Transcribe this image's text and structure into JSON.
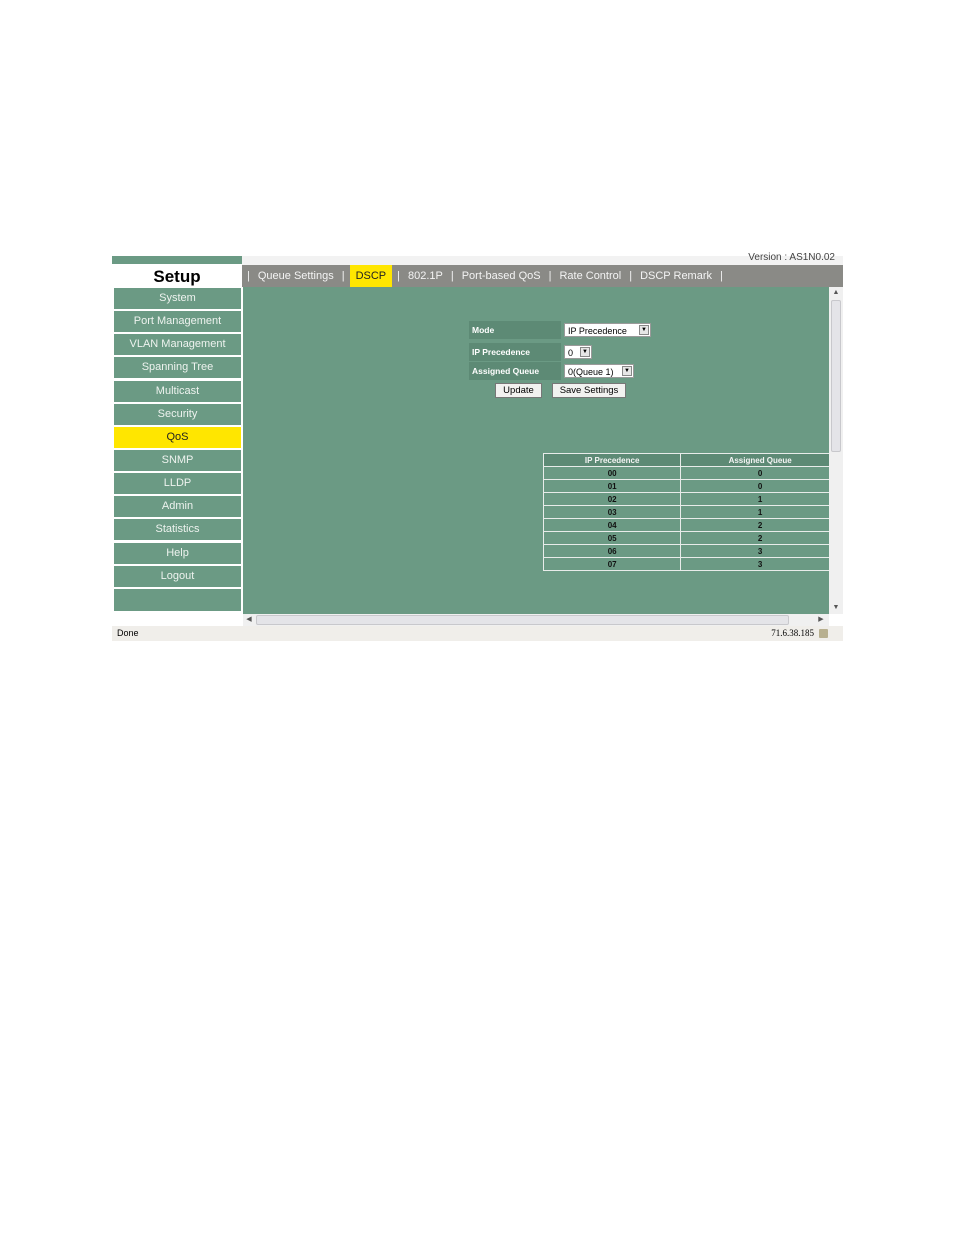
{
  "sidebar": {
    "title": "Setup",
    "items": [
      {
        "label": "System"
      },
      {
        "label": "Port Management"
      },
      {
        "label": "VLAN Management"
      },
      {
        "label": "Spanning Tree"
      },
      {
        "label": "Multicast"
      },
      {
        "label": "Security"
      },
      {
        "label": "QoS",
        "active": true
      },
      {
        "label": "SNMP"
      },
      {
        "label": "LLDP"
      },
      {
        "label": "Admin"
      },
      {
        "label": "Statistics"
      },
      {
        "label": "Help"
      },
      {
        "label": "Logout"
      }
    ]
  },
  "header": {
    "version": "Version : AS1N0.02",
    "tabs": [
      {
        "label": "Queue Settings"
      },
      {
        "label": "DSCP",
        "active": true
      },
      {
        "label": "802.1P"
      },
      {
        "label": "Port-based QoS"
      },
      {
        "label": "Rate Control"
      },
      {
        "label": "DSCP Remark"
      }
    ],
    "separator": "|"
  },
  "form": {
    "mode_label": "Mode",
    "mode_value": "IP Precedence",
    "ip_precedence_label": "IP Precedence",
    "ip_precedence_value": "0",
    "assigned_queue_label": "Assigned Queue",
    "assigned_queue_value": "0(Queue 1)",
    "update_label": "Update",
    "save_label": "Save Settings"
  },
  "table": {
    "headers": [
      "IP Precedence",
      "Assigned Queue"
    ],
    "rows": [
      [
        "00",
        "0"
      ],
      [
        "01",
        "0"
      ],
      [
        "02",
        "1"
      ],
      [
        "03",
        "1"
      ],
      [
        "04",
        "2"
      ],
      [
        "05",
        "2"
      ],
      [
        "06",
        "3"
      ],
      [
        "07",
        "3"
      ]
    ]
  },
  "statusbar": {
    "status": "Done",
    "address": "71.6.38.185"
  },
  "colors": {
    "panel_green": "#6b9a84",
    "label_green": "#5d8a75",
    "active_yellow": "#ffe600",
    "tabbar_gray": "#8a8a86"
  }
}
